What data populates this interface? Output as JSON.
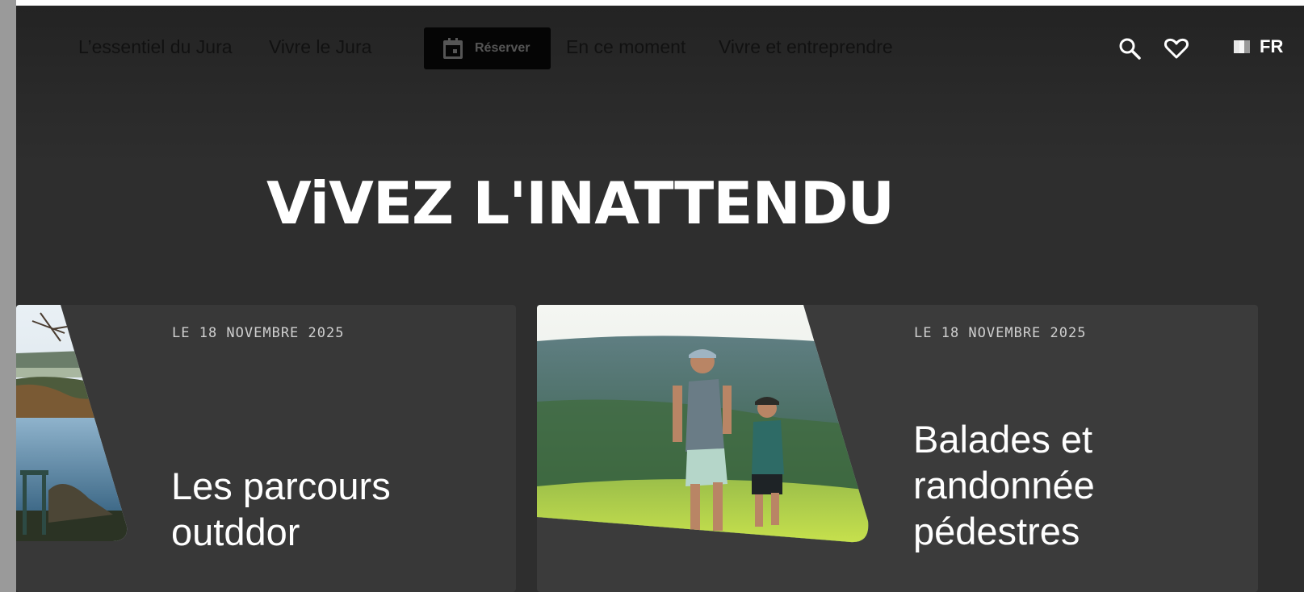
{
  "nav": {
    "links": [
      "L’essentiel du Jura",
      "Vivre le Jura",
      "En ce moment",
      "Vivre et entreprendre"
    ],
    "book_label": "Réserver",
    "language": "FR"
  },
  "hero": {
    "title": "ViVEZ L'INATTENDU"
  },
  "cards": [
    {
      "date": "LE 18 NOVEMBRE 2025",
      "title_lines": [
        "Les parcours",
        "outddor"
      ]
    },
    {
      "date": "LE 18 NOVEMBRE 2025",
      "title_lines": [
        "Balades et",
        "randonnée",
        "pédestres"
      ]
    }
  ],
  "icons": {
    "calendar": "calendar-icon",
    "search": "search-icon",
    "favorites": "heart-icon",
    "flag": "french-flag-icon"
  },
  "colors": {
    "background": "#2e2e2e",
    "card": "#383838",
    "book_button": "#050505",
    "text": "#ffffff"
  }
}
